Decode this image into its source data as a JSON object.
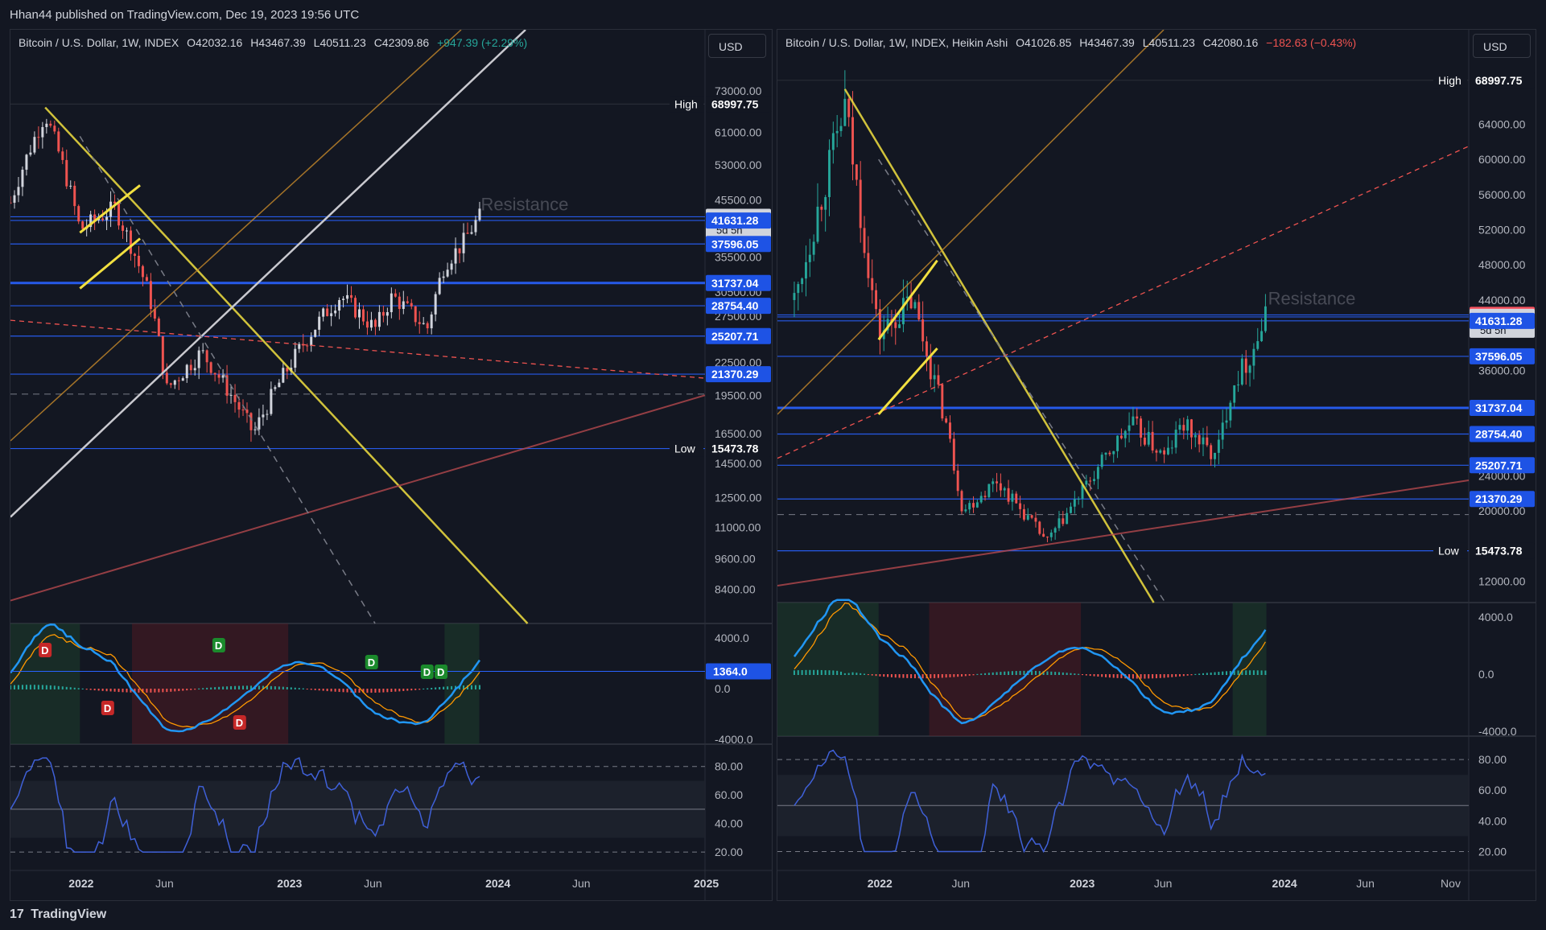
{
  "header": {
    "published": "Hhan44 published on TradingView.com, Dec 19, 2023 19:56 UTC"
  },
  "footer": {
    "brand": "TradingView",
    "logo_mark": "17"
  },
  "colors": {
    "bg": "#131722",
    "grid": "#2a2e39",
    "up": "#26a69a",
    "down": "#ef5350",
    "blue_line": "#2962ff",
    "yellow": "#f2e040",
    "price_tag": "#1e53e5"
  },
  "left_chart": {
    "legend": {
      "symbol": "Bitcoin / U.S. Dollar, 1W, INDEX",
      "open": "O42032.16",
      "high": "H43467.39",
      "low": "L40511.23",
      "close": "C42309.86",
      "change": "+947.39 (+2.29%)"
    },
    "currency": "USD",
    "resistance_label": "Resistance",
    "price_axis": [
      "73000.00",
      "61000.00",
      "53000.00",
      "45500.00",
      "39500.00",
      "35500.00",
      "30500.00",
      "27500.00",
      "22500.00",
      "19500.00",
      "16500.00",
      "14500.00",
      "12500.00",
      "11000.00",
      "9600.00",
      "8400.00"
    ],
    "price_tags": [
      {
        "value": "68997.75",
        "label": "High"
      },
      {
        "value": "42309.86",
        "sub": "5d 5h"
      },
      {
        "value": "41631.28"
      },
      {
        "value": "37596.05"
      },
      {
        "value": "31737.04"
      },
      {
        "value": "28754.40"
      },
      {
        "value": "25207.71"
      },
      {
        "value": "21370.29"
      },
      {
        "value": "15473.78",
        "label": "Low"
      }
    ],
    "macd_axis": [
      "4000.0",
      "0.0",
      "-4000.0"
    ],
    "macd_tag": "1364.0",
    "rsi_axis": [
      "80.00",
      "60.00",
      "40.00",
      "20.00"
    ],
    "time_axis": [
      "2022",
      "Jun",
      "2023",
      "Jun",
      "2024",
      "Jun",
      "2025"
    ],
    "signals": [
      "D",
      "D",
      "D",
      "D",
      "D",
      "D",
      "D"
    ]
  },
  "right_chart": {
    "legend": {
      "symbol": "Bitcoin / U.S. Dollar, 1W, INDEX, Heikin Ashi",
      "open": "O41026.85",
      "high": "H43467.39",
      "low": "L40511.23",
      "close": "C42080.16",
      "change": "−182.63 (−0.43%)"
    },
    "currency": "USD",
    "resistance_label": "Resistance",
    "price_axis": [
      "64000.00",
      "60000.00",
      "56000.00",
      "52000.00",
      "48000.00",
      "44000.00",
      "36000.00",
      "24000.00",
      "20000.00",
      "12000.00"
    ],
    "price_tags": [
      {
        "value": "68997.75",
        "label": "High"
      },
      {
        "value": "42309.86"
      },
      {
        "value": "42080.16",
        "sub": "5d 5h"
      },
      {
        "value": "41631.28"
      },
      {
        "value": "37596.05"
      },
      {
        "value": "31737.04"
      },
      {
        "value": "28754.40"
      },
      {
        "value": "25207.71"
      },
      {
        "value": "21370.29"
      },
      {
        "value": "15473.78",
        "label": "Low"
      }
    ],
    "macd_axis": [
      "4000.0",
      "0.0",
      "-4000.0"
    ],
    "rsi_axis": [
      "80.00",
      "60.00",
      "40.00",
      "20.00"
    ],
    "time_axis": [
      "2022",
      "Jun",
      "2023",
      "Jun",
      "2024",
      "Jun",
      "Nov"
    ]
  },
  "chart_data": [
    {
      "type": "candlestick",
      "title": "Bitcoin / U.S. Dollar, 1W, INDEX",
      "ylim": [
        7500,
        80000
      ],
      "log_scale": true,
      "x_range": [
        "2021-09",
        "2025-01"
      ],
      "anchor_prices": [
        [
          "2021-09",
          45000
        ],
        [
          "2021-11",
          66000
        ],
        [
          "2022-01",
          40000
        ],
        [
          "2022-03",
          44000
        ],
        [
          "2022-05",
          30000
        ],
        [
          "2022-06",
          20000
        ],
        [
          "2022-08",
          23500
        ],
        [
          "2022-11",
          16500
        ],
        [
          "2023-01",
          22000
        ],
        [
          "2023-03",
          27500
        ],
        [
          "2023-04",
          30000
        ],
        [
          "2023-06",
          26000
        ],
        [
          "2023-07",
          30000
        ],
        [
          "2023-09",
          26000
        ],
        [
          "2023-10",
          34500
        ],
        [
          "2023-11",
          37500
        ],
        [
          "2023-12",
          42309.86
        ]
      ],
      "horizontal_levels": [
        68997.75,
        42309.86,
        41631.28,
        37596.05,
        31737.04,
        28754.4,
        25207.71,
        21370.29,
        15473.78
      ]
    },
    {
      "type": "candlestick",
      "title": "Bitcoin / U.S. Dollar, 1W, INDEX, Heikin Ashi",
      "ylim": [
        10500,
        72000
      ],
      "x_range": [
        "2021-07",
        "2024-12"
      ],
      "anchor_prices": [
        [
          "2021-08",
          44000
        ],
        [
          "2021-11",
          66000
        ],
        [
          "2022-01",
          40000
        ],
        [
          "2022-03",
          44000
        ],
        [
          "2022-05",
          30000
        ],
        [
          "2022-06",
          20000
        ],
        [
          "2022-08",
          23500
        ],
        [
          "2022-11",
          16500
        ],
        [
          "2023-01",
          22000
        ],
        [
          "2023-03",
          27500
        ],
        [
          "2023-04",
          30000
        ],
        [
          "2023-06",
          26000
        ],
        [
          "2023-07",
          30000
        ],
        [
          "2023-09",
          26000
        ],
        [
          "2023-10",
          34500
        ],
        [
          "2023-11",
          37500
        ],
        [
          "2023-12",
          42080.16
        ]
      ],
      "horizontal_levels": [
        68997.75,
        42309.86,
        42080.16,
        41631.28,
        37596.05,
        31737.04,
        28754.4,
        25207.71,
        21370.29,
        15473.78
      ]
    }
  ]
}
